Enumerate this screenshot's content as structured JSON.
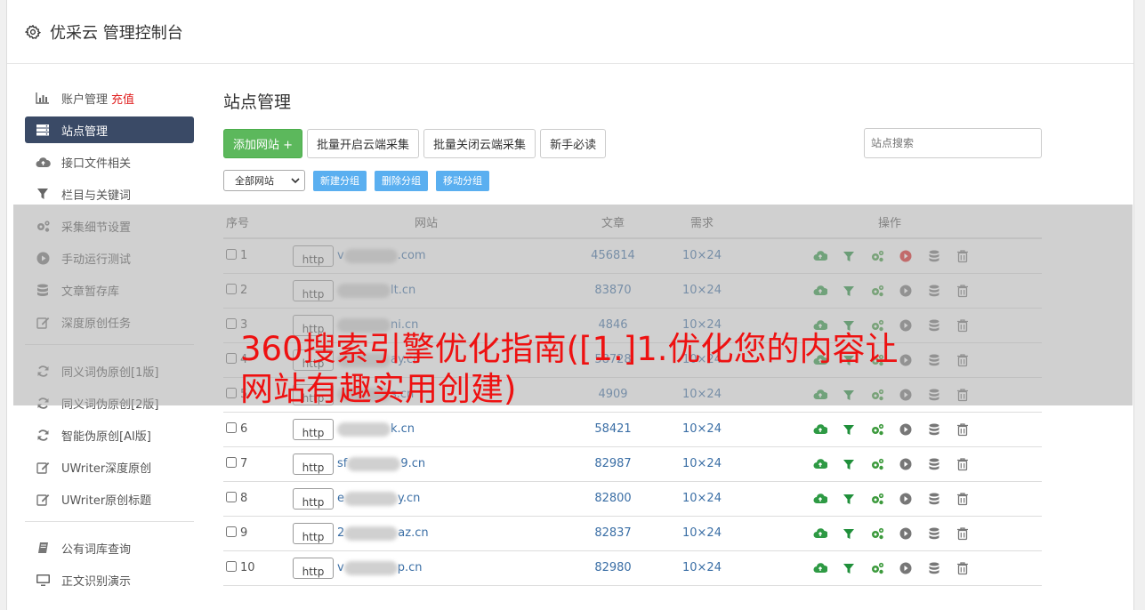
{
  "header": {
    "title": "优采云 管理控制台"
  },
  "sidebar": {
    "group1": [
      {
        "label": "账户管理",
        "extra": "充值",
        "icon": "bar-chart-icon"
      },
      {
        "label": "站点管理",
        "icon": "server-icon",
        "active": true
      },
      {
        "label": "接口文件相关",
        "icon": "cloud-upload-icon"
      },
      {
        "label": "栏目与关键词",
        "icon": "filter-icon"
      },
      {
        "label": "采集细节设置",
        "icon": "gears-icon"
      },
      {
        "label": "手动运行测试",
        "icon": "play-icon"
      },
      {
        "label": "文章暂存库",
        "icon": "database-icon"
      },
      {
        "label": "深度原创任务",
        "icon": "edit-icon"
      }
    ],
    "group2": [
      {
        "label": "同义词伪原创[1版]",
        "icon": "refresh-icon"
      },
      {
        "label": "同义词伪原创[2版]",
        "icon": "refresh-icon"
      },
      {
        "label": "智能伪原创[AI版]",
        "icon": "refresh-icon"
      },
      {
        "label": "UWriter深度原创",
        "icon": "edit-icon"
      },
      {
        "label": "UWriter原创标题",
        "icon": "edit-icon"
      }
    ],
    "group3": [
      {
        "label": "公有词库查询",
        "icon": "book-icon"
      },
      {
        "label": "正文识别演示",
        "icon": "monitor-icon"
      }
    ]
  },
  "main": {
    "title": "站点管理",
    "buttons": {
      "add": "添加网站 +",
      "batch_open": "批量开启云端采集",
      "batch_close": "批量关闭云端采集",
      "guide": "新手必读"
    },
    "search_placeholder": "站点搜索",
    "group_select": "全部网站",
    "group_buttons": {
      "new": "新建分组",
      "delete": "删除分组",
      "move": "移动分组"
    },
    "columns": {
      "num": "序号",
      "site": "网站",
      "articles": "文章",
      "demand": "需求",
      "ops": "操作"
    },
    "http_label": "http",
    "rows": [
      {
        "num": "1",
        "pre": "v",
        "post": ".com",
        "articles": "456814",
        "demand": "10×24",
        "run_active": true
      },
      {
        "num": "2",
        "pre": "",
        "post": "lt.cn",
        "articles": "83870",
        "demand": "10×24"
      },
      {
        "num": "3",
        "pre": "",
        "post": "ni.cn",
        "articles": "4846",
        "demand": "10×24"
      },
      {
        "num": "4",
        "pre": "",
        "post": "ay.cn",
        "articles": "58728",
        "demand": "10×24"
      },
      {
        "num": "5",
        "pre": "",
        "post": "s.cn",
        "articles": "4909",
        "demand": "10×24"
      },
      {
        "num": "6",
        "pre": "",
        "post": "k.cn",
        "articles": "58421",
        "demand": "10×24"
      },
      {
        "num": "7",
        "pre": "sf",
        "post": "9.cn",
        "articles": "82987",
        "demand": "10×24"
      },
      {
        "num": "8",
        "pre": "e",
        "post": "y.cn",
        "articles": "82800",
        "demand": "10×24"
      },
      {
        "num": "9",
        "pre": "2",
        "post": "az.cn",
        "articles": "82837",
        "demand": "10×24"
      },
      {
        "num": "10",
        "pre": "v",
        "post": "p.cn",
        "articles": "82980",
        "demand": "10×24"
      }
    ]
  },
  "overlay": {
    "text": "360搜索引擎优化指南([1.]1.优化您的内容让网站有趣实用创建)"
  },
  "colors": {
    "active_nav": "#3a4a66",
    "green_button": "#5cb85c",
    "blue_button": "#5aaff0",
    "overlay_text": "#ee1111"
  }
}
